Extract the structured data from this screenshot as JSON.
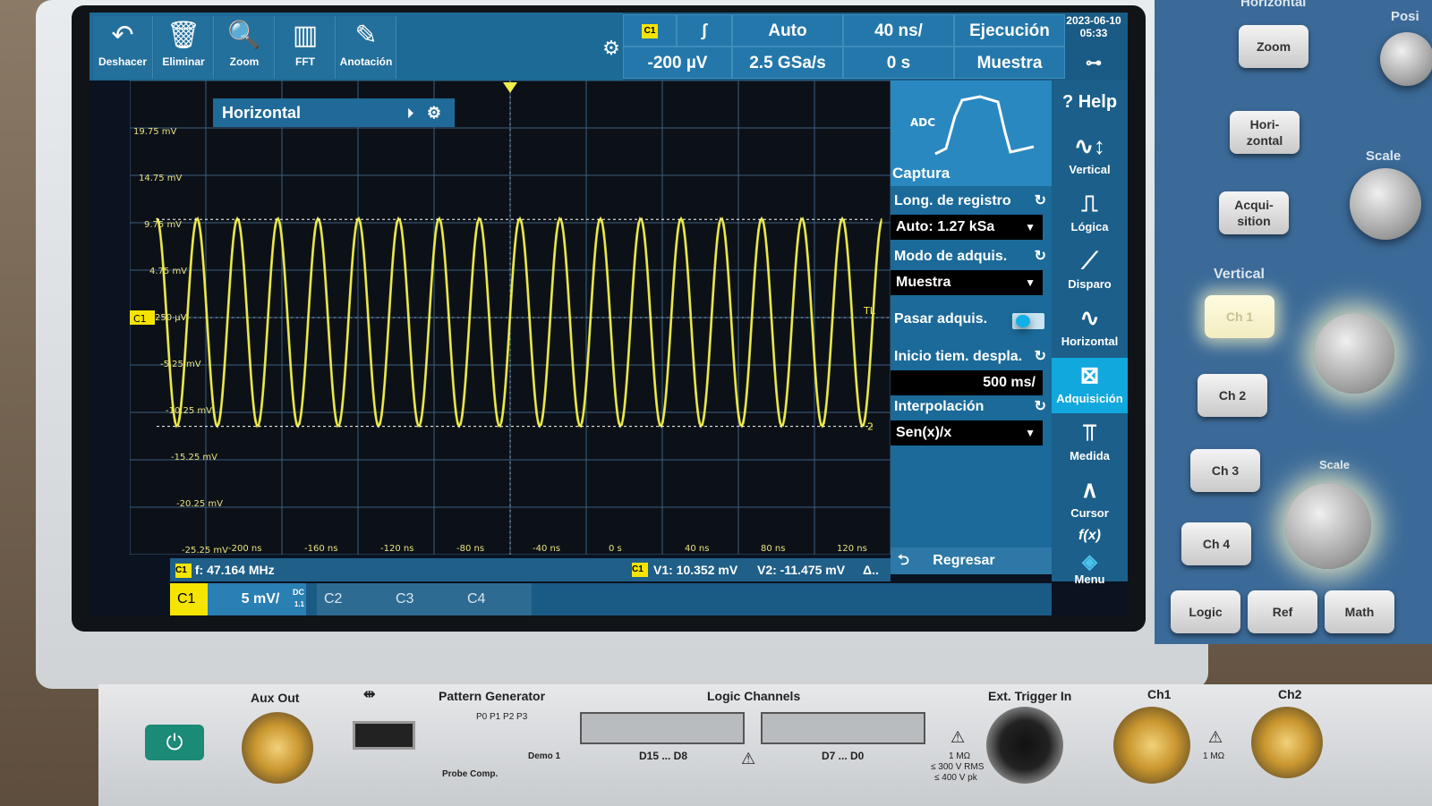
{
  "toolbar": {
    "buttons": [
      {
        "label": "Deshacer",
        "icon": "undo-icon",
        "glyph": "↶"
      },
      {
        "label": "Eliminar",
        "icon": "trash-icon",
        "glyph": "🗑"
      },
      {
        "label": "Zoom",
        "icon": "zoom-icon",
        "glyph": "🔍"
      },
      {
        "label": "FFT",
        "icon": "fft-icon",
        "glyph": "▥"
      },
      {
        "label": "Anotación",
        "icon": "pencil-icon",
        "glyph": "✎"
      }
    ]
  },
  "status": {
    "trigger_source": "C1",
    "trigger_slope": "∫",
    "trigger_mode": "Auto",
    "timebase": "40 ns/",
    "run_state": "Ejecución",
    "trigger_level": "-200 µV",
    "sample_rate": "2.5 GSa/s",
    "offset": "0 s",
    "acq_mode": "Muestra",
    "date": "2023-06-10",
    "time": "05:33"
  },
  "horizontal_tab": {
    "label": "Horizontal"
  },
  "graticule": {
    "y_labels": [
      "19.75 mV",
      "14.75 mV",
      "9.75 mV",
      "4.75 mV",
      "250 µV",
      "-5.25 mV",
      "-10.25 mV",
      "-15.25 mV",
      "-20.25 mV",
      "-25.25 mV"
    ],
    "x_labels": [
      "-200 ns",
      "-160 ns",
      "-120 ns",
      "-80 ns",
      "-40 ns",
      "0 s",
      "40 ns",
      "80 ns",
      "120 ns"
    ],
    "channel_marker": "C1",
    "trigger_marker": "TL",
    "cursor_marker": "2"
  },
  "panel": {
    "adc_label": "ADC",
    "section_title": "Captura",
    "record_length_label": "Long. de registro",
    "record_length_value": "Auto: 1.27 kSa",
    "acq_mode_label": "Modo de adquis.",
    "acq_mode_value": "Muestra",
    "pass_acq_label": "Pasar adquis.",
    "pass_acq_on": true,
    "roll_start_label": "Inicio tiem. despla.",
    "roll_start_value": "500 ms/",
    "interp_label": "Interpolación",
    "interp_value": "Sen(x)/x",
    "back_label": "Regresar"
  },
  "nav": {
    "items": [
      {
        "label": "Help",
        "icon": "help-icon",
        "glyph": "?"
      },
      {
        "label": "Vertical",
        "icon": "vertical-icon",
        "glyph": "∿↕"
      },
      {
        "label": "Lógica",
        "icon": "logic-icon",
        "glyph": "⎍"
      },
      {
        "label": "Disparo",
        "icon": "trigger-icon",
        "glyph": "⟋"
      },
      {
        "label": "Horizontal",
        "icon": "horizontal-icon",
        "glyph": "∿"
      },
      {
        "label": "Adquisición",
        "icon": "acquisition-icon",
        "glyph": "⊠",
        "active": true
      },
      {
        "label": "Medida",
        "icon": "measure-icon",
        "glyph": "⫪"
      },
      {
        "label": "Cursor",
        "icon": "cursor-icon",
        "glyph": "∧"
      },
      {
        "label": "f(x)",
        "icon": "function-icon",
        "glyph": ""
      },
      {
        "label": "Menu",
        "icon": "menu-icon",
        "glyph": "◈"
      }
    ]
  },
  "measurements": {
    "channel": "C1",
    "frequency": "f: 47.164 MHz",
    "v1": "V1: 10.352 mV",
    "v2": "V2: -11.475 mV",
    "delta": "Δ.."
  },
  "channel_bar": {
    "c1": "C1",
    "c1_scale": "5 mV/",
    "c1_coupling": "DC",
    "c1_impedance": "1.1",
    "c2": "C2",
    "c3": "C3",
    "c4": "C4"
  },
  "side_panel": {
    "top_label": "Horizontal",
    "zoom": "Zoom",
    "horizontal": "Hori-\nzontal",
    "acquisition": "Acqui-\nsition",
    "scale_label": "Scale",
    "vertical_label": "Vertical",
    "ch1": "Ch 1",
    "ch2": "Ch 2",
    "ch3": "Ch 3",
    "ch4": "Ch 4",
    "scale_label_2": "Scale",
    "logic": "Logic",
    "ref": "Ref",
    "math": "Math",
    "pos_label": "Posi"
  },
  "front_panel": {
    "aux_out": "Aux Out",
    "pattern_gen": "Pattern Generator",
    "pins": "P0   P1   P2   P3",
    "probe_comp": "Probe Comp.",
    "demo": "Demo 1",
    "logic_channels": "Logic Channels",
    "d_high": "D15 ... D8",
    "d_low": "D7 ... D0",
    "ext_trigger": "Ext. Trigger In",
    "ext_spec_1": "1 MΩ",
    "ext_spec_2": "≤ 300 V RMS",
    "ext_spec_3": "≤ 400 V pk",
    "ch1": "Ch1",
    "ch2": "Ch2",
    "ch1_spec": "1 MΩ"
  },
  "waveform": {
    "frequency_mhz": 47.164,
    "amplitude_mv": 11.0,
    "offset_mv": -0.5,
    "color": "#f2ef4a"
  }
}
